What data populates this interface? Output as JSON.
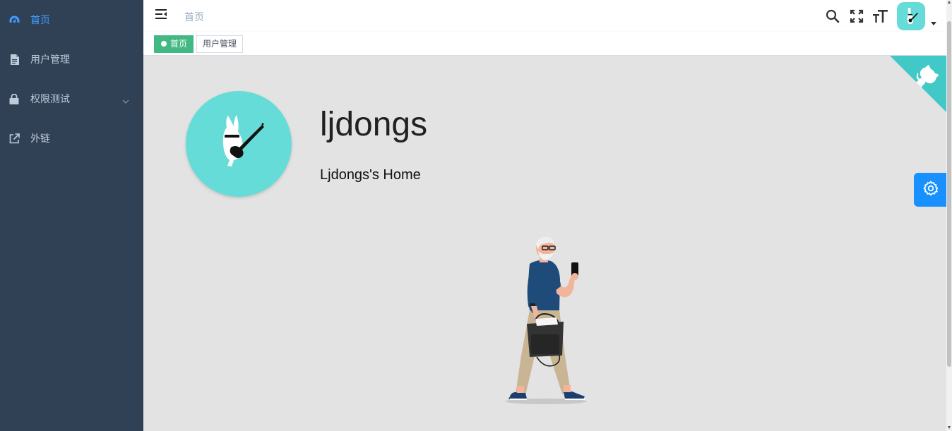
{
  "sidebar": {
    "items": [
      {
        "label": "首页",
        "icon": "dashboard-icon",
        "active": true
      },
      {
        "label": "用户管理",
        "icon": "document-icon"
      },
      {
        "label": "权限测试",
        "icon": "lock-icon",
        "expandable": true
      },
      {
        "label": "外链",
        "icon": "external-link-icon"
      }
    ]
  },
  "navbar": {
    "breadcrumb": "首页",
    "icons": [
      "search-icon",
      "fullscreen-icon",
      "text-size-icon"
    ]
  },
  "tags": [
    {
      "label": "首页",
      "active": true
    },
    {
      "label": "用户管理",
      "active": false
    }
  ],
  "profile": {
    "name": "ljdongs",
    "role": "Ljdongs's Home"
  },
  "colors": {
    "sidebar_bg": "#304156",
    "sidebar_text": "#bfcbd9",
    "active_link": "#409eff",
    "active_tag": "#42b983",
    "avatar_bg": "#66dcd8",
    "settings_btn": "#1890ff",
    "main_bg": "#e3e3e3"
  }
}
